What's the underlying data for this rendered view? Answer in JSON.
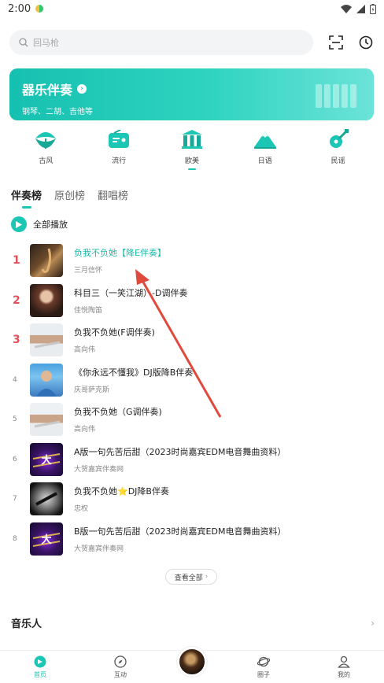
{
  "status": {
    "time": "2:00"
  },
  "search": {
    "placeholder": "回马枪"
  },
  "banner": {
    "title": "器乐伴奏",
    "subtitle": "钢琴、二胡、吉他等"
  },
  "categories": [
    {
      "label": "古风",
      "icon": "umbrella-icon"
    },
    {
      "label": "流行",
      "icon": "radio-icon"
    },
    {
      "label": "欧美",
      "icon": "building-icon"
    },
    {
      "label": "日语",
      "icon": "mountain-icon"
    },
    {
      "label": "民谣",
      "icon": "guitar-icon"
    }
  ],
  "tabs": [
    {
      "label": "伴奏榜",
      "active": true
    },
    {
      "label": "原创榜",
      "active": false
    },
    {
      "label": "翻唱榜",
      "active": false
    }
  ],
  "play_all": {
    "label": "全部播放"
  },
  "songs": [
    {
      "rank": "1",
      "title": "负我不负她【降E伴奏】",
      "artist": "三月信怀"
    },
    {
      "rank": "2",
      "title": "科目三（一笑江湖）-D调伴奏",
      "artist": "佳悦陶笛"
    },
    {
      "rank": "3",
      "title": "负我不负她(F调伴奏)",
      "artist": "高向伟"
    },
    {
      "rank": "4",
      "title": "《你永远不懂我》DJ版降B伴奏",
      "artist": "庆哥萨克斯"
    },
    {
      "rank": "5",
      "title": "负我不负她（G调伴奏)",
      "artist": "高向伟"
    },
    {
      "rank": "6",
      "title": "A版一句先苦后甜（2023时尚嘉宾EDM电音舞曲资料）",
      "artist": "大贺嘉宾伴奏网"
    },
    {
      "rank": "7",
      "title": "负我不负她⭐DJ降B伴奏",
      "artist": "忠权"
    },
    {
      "rank": "8",
      "title": "B版一句先苦后甜（2023时尚嘉宾EDM电音舞曲资料）",
      "artist": "大贺嘉宾伴奏网"
    }
  ],
  "view_all": {
    "label": "查看全部"
  },
  "musicians": {
    "title": "音乐人"
  },
  "bottom_nav": [
    {
      "label": "首页",
      "active": true
    },
    {
      "label": "互动",
      "active": false
    },
    {
      "label": "圈子",
      "active": false
    },
    {
      "label": "我的",
      "active": false
    }
  ],
  "colors": {
    "accent": "#1cc6b4",
    "rank_top": "#e4505a",
    "annotation_arrow": "#e04a3c"
  }
}
